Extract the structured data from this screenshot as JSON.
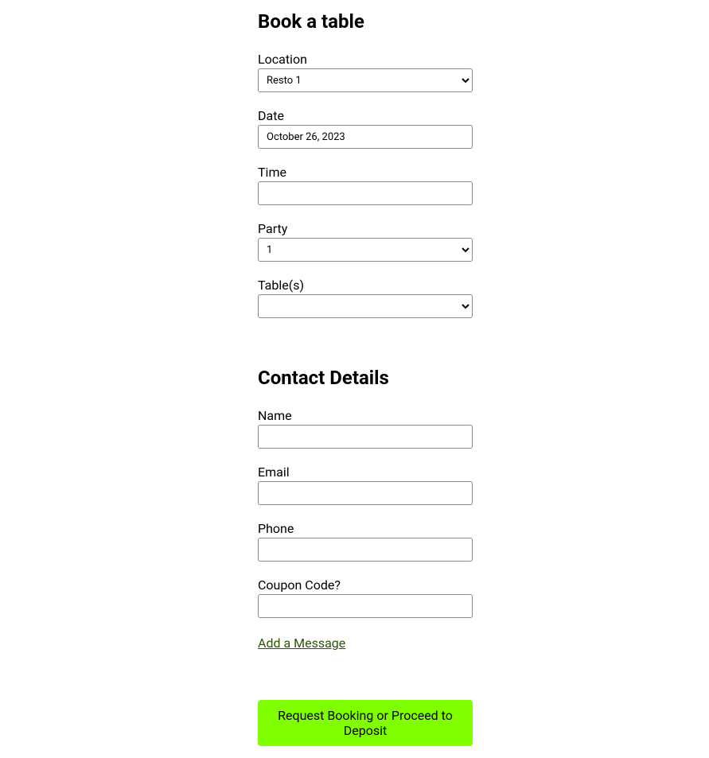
{
  "booking": {
    "title": "Book a table",
    "location": {
      "label": "Location",
      "selected": "Resto 1"
    },
    "date": {
      "label": "Date",
      "value": "October 26, 2023"
    },
    "time": {
      "label": "Time",
      "value": ""
    },
    "party": {
      "label": "Party",
      "selected": "1"
    },
    "tables": {
      "label": "Table(s)",
      "selected": ""
    }
  },
  "contact": {
    "title": "Contact Details",
    "name": {
      "label": "Name",
      "value": ""
    },
    "email": {
      "label": "Email",
      "value": ""
    },
    "phone": {
      "label": "Phone",
      "value": ""
    },
    "coupon": {
      "label": "Coupon Code?",
      "value": ""
    },
    "add_message": "Add a Message"
  },
  "submit": {
    "label": "Request Booking or Proceed to Deposit"
  }
}
